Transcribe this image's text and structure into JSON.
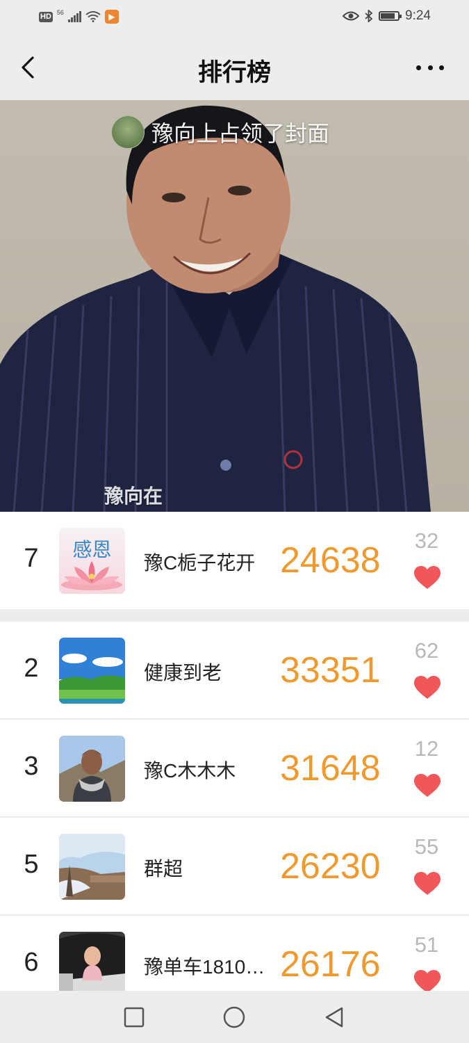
{
  "status_bar": {
    "network_badge": "HD",
    "signal_label": "56",
    "time": "9:24",
    "icons": [
      "hd-icon",
      "signal-icon",
      "wifi-icon",
      "app-icon",
      "eye-icon",
      "bluetooth-icon",
      "battery-icon"
    ],
    "battery_level": 0.85
  },
  "header": {
    "title": "排行榜",
    "back_icon": "back-chevron-icon",
    "more_icon": "more-dots-icon"
  },
  "cover": {
    "caption": "豫向上占领了封面",
    "watermark": "豫向在"
  },
  "my_rank": {
    "rank": "7",
    "name": "豫C栀子花开",
    "avatar_text": "感恩",
    "score": "24638",
    "likes": "32"
  },
  "ranking": [
    {
      "rank": "2",
      "name": "健康到老",
      "score": "33351",
      "likes": "62"
    },
    {
      "rank": "3",
      "name": "豫C木木木",
      "score": "31648",
      "likes": "12"
    },
    {
      "rank": "5",
      "name": "群超",
      "score": "26230",
      "likes": "55"
    },
    {
      "rank": "6",
      "name": "豫单车1810…",
      "score": "26176",
      "likes": "51"
    }
  ],
  "colors": {
    "score": "#ef9a2f",
    "heart": "#f0575b",
    "likes": "#b8b8b8",
    "background": "#ededed"
  },
  "system_nav": [
    "square-icon",
    "circle-icon",
    "triangle-back-icon"
  ]
}
